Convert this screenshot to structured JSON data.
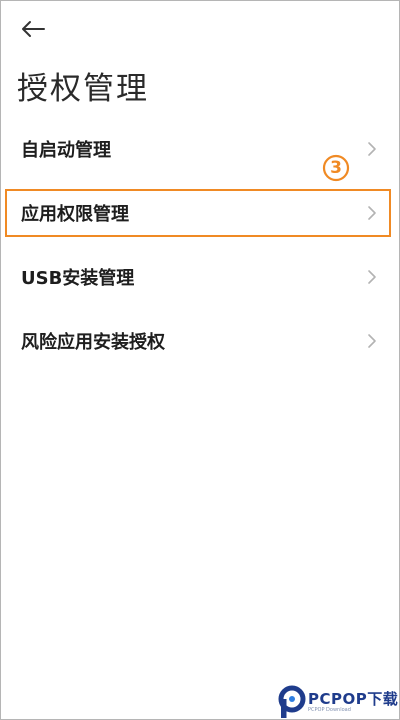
{
  "header": {
    "back_icon": "arrow-left-icon",
    "title": "授权管理"
  },
  "menu": {
    "items": [
      {
        "label": "自启动管理",
        "icon": "chevron-right-icon"
      },
      {
        "label": "应用权限管理",
        "icon": "chevron-right-icon"
      },
      {
        "label": "USB安装管理",
        "icon": "chevron-right-icon"
      },
      {
        "label": "风险应用安装授权",
        "icon": "chevron-right-icon"
      }
    ]
  },
  "annotation": {
    "step": "3",
    "color": "#f08a24"
  },
  "watermark": {
    "brand": "PCPOP下载",
    "sub": "PCPOP Download",
    "color": "#1f3c8c"
  }
}
